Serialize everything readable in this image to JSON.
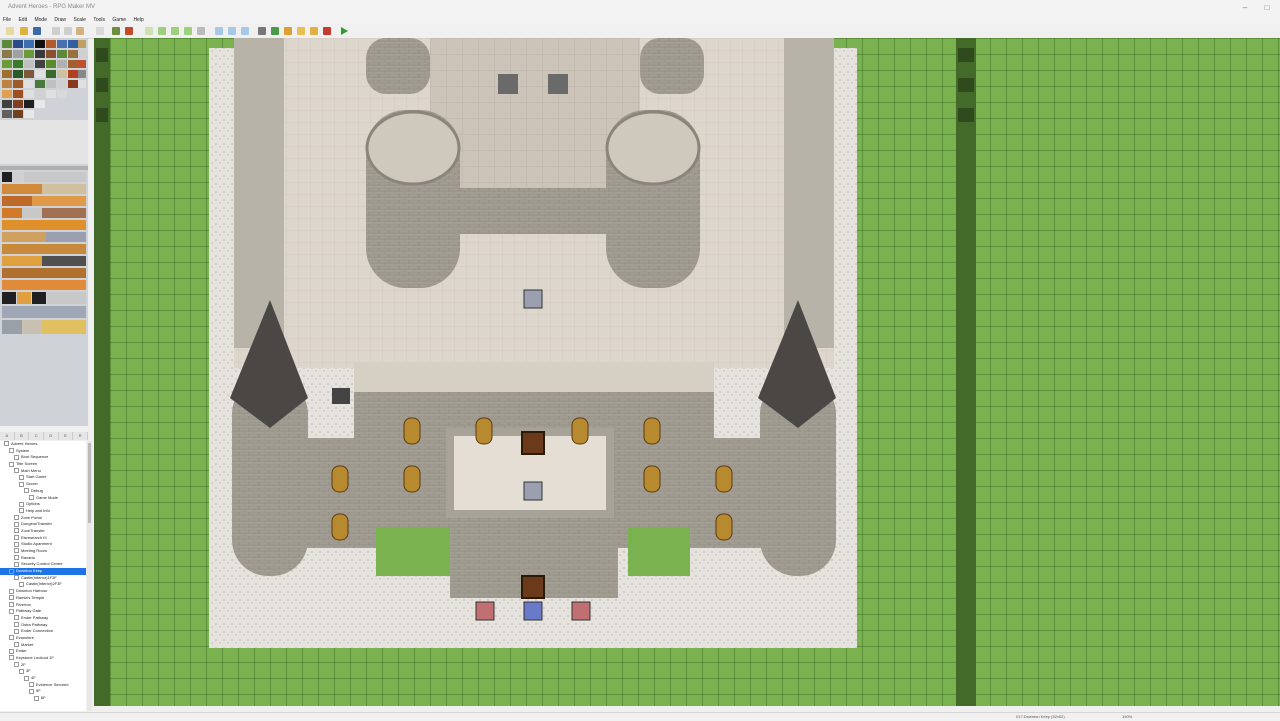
{
  "window": {
    "title": "Advent Heroes - RPG Maker MV"
  },
  "menu": [
    "File",
    "Edit",
    "Mode",
    "Draw",
    "Scale",
    "Tools",
    "Game",
    "Help"
  ],
  "toolbar_icons": [
    "new-project-icon",
    "open-project-icon",
    "save-project-icon",
    "cut-icon",
    "copy-icon",
    "paste-icon",
    "delete-icon",
    "undo-icon",
    "map-mode-icon",
    "event-mode-icon",
    "pencil-icon",
    "rectangle-icon",
    "ellipse-icon",
    "fill-icon",
    "shadow-pen-icon",
    "zoom-in-icon",
    "zoom-out-icon",
    "actual-size-icon",
    "database-icon",
    "plugin-manager-icon",
    "sound-test-icon",
    "event-searcher-icon",
    "resource-manager-icon",
    "character-generator-icon",
    "playtest-icon"
  ],
  "tileset_tabs": [
    "A",
    "B",
    "C",
    "D",
    "E",
    "R"
  ],
  "map_tree": [
    {
      "label": "Advent Heroes",
      "depth": 0
    },
    {
      "label": "System",
      "depth": 1
    },
    {
      "label": "Boot Sequence",
      "depth": 2
    },
    {
      "label": "Title Screen",
      "depth": 1
    },
    {
      "label": "Main Menu",
      "depth": 2
    },
    {
      "label": "Start Game",
      "depth": 3
    },
    {
      "label": "Secret",
      "depth": 3
    },
    {
      "label": "Debug",
      "depth": 4
    },
    {
      "label": "Game Mode",
      "depth": 5
    },
    {
      "label": "Options",
      "depth": 3
    },
    {
      "label": "Help and Info",
      "depth": 3
    },
    {
      "label": "Zone Portal",
      "depth": 2
    },
    {
      "label": "DungeonTransfer",
      "depth": 2
    },
    {
      "label": "ZoneTransfer",
      "depth": 2
    },
    {
      "label": "Eisresearch III",
      "depth": 2
    },
    {
      "label": "Studio Apartment",
      "depth": 2
    },
    {
      "label": "Meeting Room",
      "depth": 2
    },
    {
      "label": "Ravaria",
      "depth": 2
    },
    {
      "label": "Security Control Centre",
      "depth": 2
    },
    {
      "label": "Downton Keep",
      "depth": 1,
      "selected": true
    },
    {
      "label": "Castle(Interior)1F3F",
      "depth": 2
    },
    {
      "label": "Castle(Interior)2F3F",
      "depth": 3
    },
    {
      "label": "Downton Harbour",
      "depth": 1
    },
    {
      "label": "Ramia's Temple",
      "depth": 1
    },
    {
      "label": "Riverton",
      "depth": 1
    },
    {
      "label": "Pathway Gate",
      "depth": 1
    },
    {
      "label": "Ender Pathway",
      "depth": 2
    },
    {
      "label": "Ostra Pathway",
      "depth": 2
    },
    {
      "label": "Ender Connection",
      "depth": 2
    },
    {
      "label": "Evanshire",
      "depth": 1
    },
    {
      "label": "Market",
      "depth": 2
    },
    {
      "label": "Ender",
      "depth": 1
    },
    {
      "label": "Keystone Lookout 1F",
      "depth": 1
    },
    {
      "label": "2F",
      "depth": 2
    },
    {
      "label": "3F",
      "depth": 3
    },
    {
      "label": "4F",
      "depth": 4
    },
    {
      "label": "Evidence Secured",
      "depth": 5
    },
    {
      "label": "5F",
      "depth": 5
    },
    {
      "label": "6F",
      "depth": 6
    }
  ],
  "statusbar": {
    "map_info": "017:Downton Keep (52x52)",
    "zoom": "150%"
  },
  "colors": {
    "grass": "#79b24e",
    "stone": "#b8b3a9",
    "floor": "#ddd6cc",
    "selection": "#1e73e6"
  }
}
